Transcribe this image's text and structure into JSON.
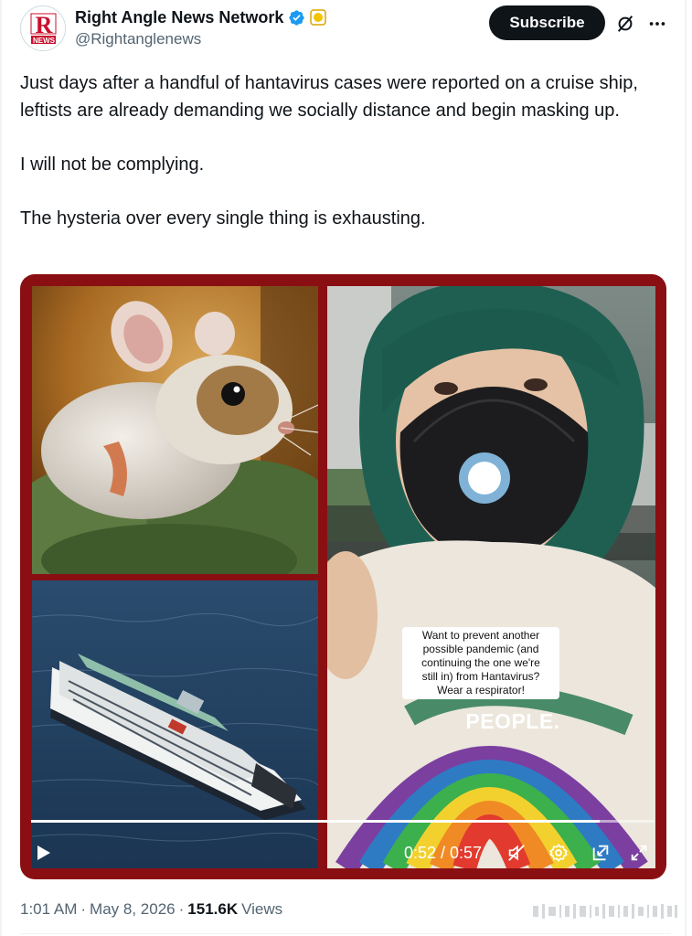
{
  "author": {
    "display_name": "Right Angle News Network",
    "handle": "@Rightanglenews",
    "avatar_text_top": "R",
    "avatar_text_bottom": "NEWS"
  },
  "header": {
    "subscribe_label": "Subscribe",
    "icons": [
      "verified-badge-icon",
      "gold-affiliate-badge-icon",
      "grok-icon",
      "more-icon"
    ]
  },
  "tweet": {
    "paragraphs": [
      "Just days after a handful of hantavirus cases were reported on a cruise ship, leftists are already demanding we socially distance and begin masking up.",
      "I will not be complying.",
      "The hysteria over every single thing is exhausting."
    ]
  },
  "media": {
    "mask_text": "PEOPLE.",
    "caption_lines": [
      "Want to prevent another",
      "possible pandemic (and",
      "continuing the one we're",
      "still in) from Hantavirus?",
      "Wear a respirator!"
    ]
  },
  "video": {
    "time_label": "0:52 / 0:57",
    "progress": 0.912,
    "icons": [
      "play-icon",
      "mute-icon",
      "settings-icon",
      "pip-icon",
      "fullscreen-icon"
    ]
  },
  "meta": {
    "timestamp": "1:01 AM",
    "separator": "·",
    "date": "May 8, 2026",
    "views_count": "151.6K",
    "views_label": "Views"
  },
  "colors": {
    "accent": "#1d9bf0",
    "media_border": "#8a0f12",
    "text_secondary": "#536471"
  }
}
